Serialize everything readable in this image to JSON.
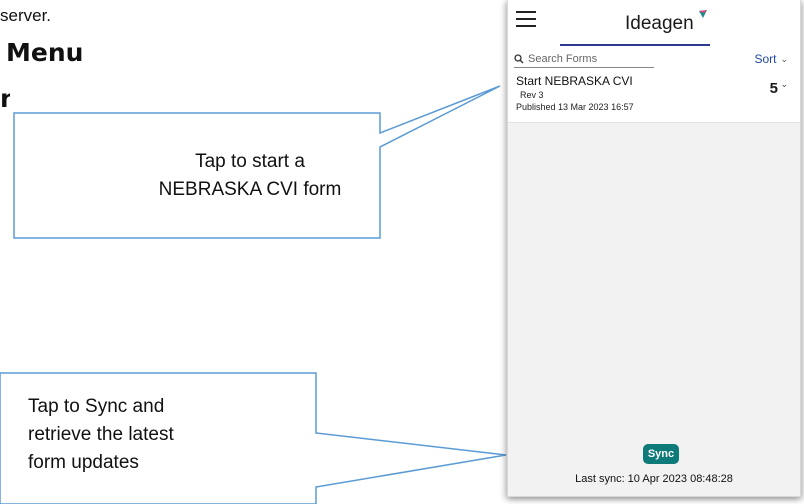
{
  "document": {
    "top_fragment": "server.",
    "heading_fragment": "Menu",
    "heading2_fragment": "n"
  },
  "callouts": [
    {
      "text": "Tap to start a\nNEBRASKA CVI form"
    },
    {
      "text": "Tap to Sync and\nretrieve the latest\nform updates"
    }
  ],
  "app": {
    "brand": "Ideagen",
    "menu_icon": "hamburger-icon",
    "search": {
      "placeholder": "Search Forms",
      "icon": "search-icon"
    },
    "sort": {
      "label": "Sort",
      "icon": "chevron-down-icon"
    },
    "forms": [
      {
        "title": "Start NEBRASKA CVI",
        "revision": "Rev 3",
        "published": "Published 13 Mar 2023 16:57",
        "count": "5"
      }
    ],
    "sync_label": "Sync",
    "last_sync": "Last sync: 10 Apr 2023 08:48:28"
  },
  "colors": {
    "accent": "#2b3a8c",
    "sync_button": "#0e7a7a",
    "sort_link": "#1d4aa0",
    "callout_border": "#5b9bd5"
  }
}
